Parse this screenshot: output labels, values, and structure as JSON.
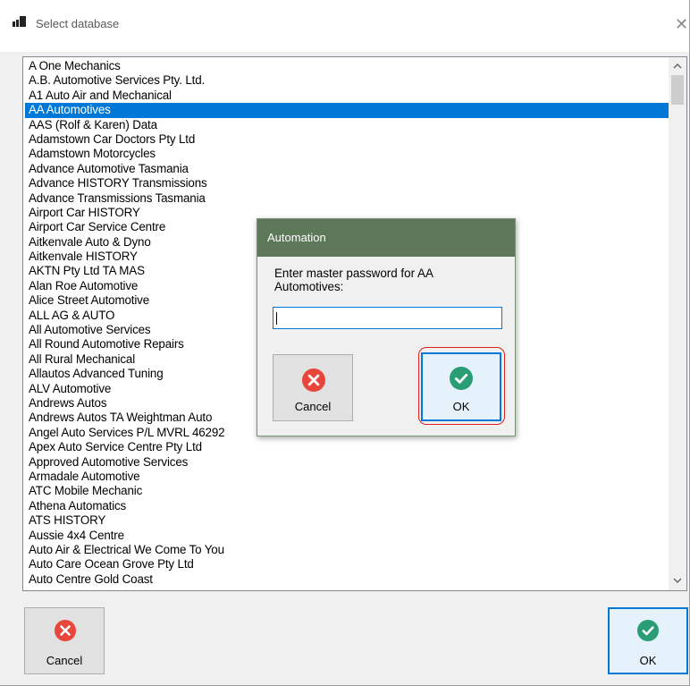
{
  "window": {
    "title": "Select database",
    "close_glyph": "✕",
    "icon": "database-window-icon"
  },
  "list": {
    "selected_index": 3,
    "items": [
      "A One Mechanics",
      "A.B. Automotive Services Pty. Ltd.",
      "A1 Auto Air and Mechanical",
      "AA Automotives",
      "AAS (Rolf & Karen) Data",
      "Adamstown Car Doctors Pty Ltd",
      "Adamstown Motorcycles",
      "Advance Automotive Tasmania",
      "Advance HISTORY Transmissions",
      "Advance Transmissions Tasmania",
      "Airport Car HISTORY",
      "Airport Car Service Centre",
      "Aitkenvale Auto & Dyno",
      "Aitkenvale HISTORY",
      "AKTN Pty Ltd TA MAS",
      "Alan Roe Automotive",
      "Alice Street Automotive",
      "ALL AG & AUTO",
      "All Automotive Services",
      "All Round Automotive Repairs",
      "All Rural Mechanical",
      "Allautos Advanced Tuning",
      "ALV Automotive",
      "Andrews Autos",
      "Andrews Autos TA Weightman Auto",
      "Angel Auto Services P/L MVRL 46292",
      "Apex Auto Service Centre Pty Ltd",
      "Approved Automotive Services",
      "Armadale Automotive",
      "ATC Mobile Mechanic",
      "Athena Automatics",
      "ATS HISTORY",
      "Aussie 4x4 Centre",
      "Auto Air & Electrical We Come To You",
      "Auto Care Ocean Grove Pty Ltd",
      "Auto Centre Gold Coast"
    ],
    "scroll_up_glyph": "▲",
    "scroll_down_glyph": "▼"
  },
  "buttons": {
    "cancel_label": "Cancel",
    "ok_label": "OK"
  },
  "dialog": {
    "title": "Automation",
    "prompt": "Enter master password for AA Automotives:",
    "password_value": "",
    "cancel_label": "Cancel",
    "ok_label": "OK"
  },
  "colors": {
    "selection": "#0078d7",
    "dialog_title_bar": "#5d7858",
    "cancel_icon": "#e8463a",
    "ok_icon": "#2a9d74",
    "highlight_ring": "#e02020"
  }
}
